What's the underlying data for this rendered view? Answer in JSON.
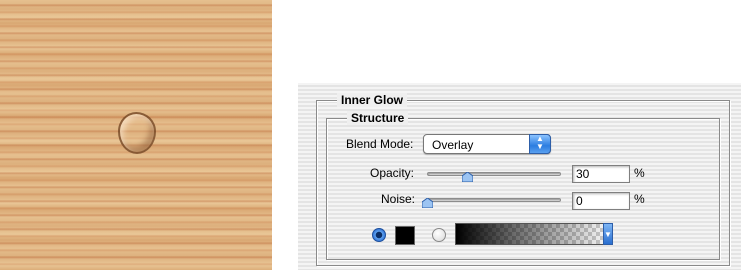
{
  "preview": {
    "description_icon": "water-drop-icon"
  },
  "dialog": {
    "group_title": "Inner Glow",
    "section_title": "Structure",
    "blend_mode": {
      "label": "Blend Mode:",
      "value": "Overlay"
    },
    "opacity": {
      "label": "Opacity:",
      "value": "30",
      "unit": "%",
      "level": 0.3
    },
    "noise": {
      "label": "Noise:",
      "value": "0",
      "unit": "%",
      "level": 0
    },
    "color_mode": {
      "solid_selected": true,
      "solid_color": "#000000",
      "gradient_selected": false
    }
  }
}
